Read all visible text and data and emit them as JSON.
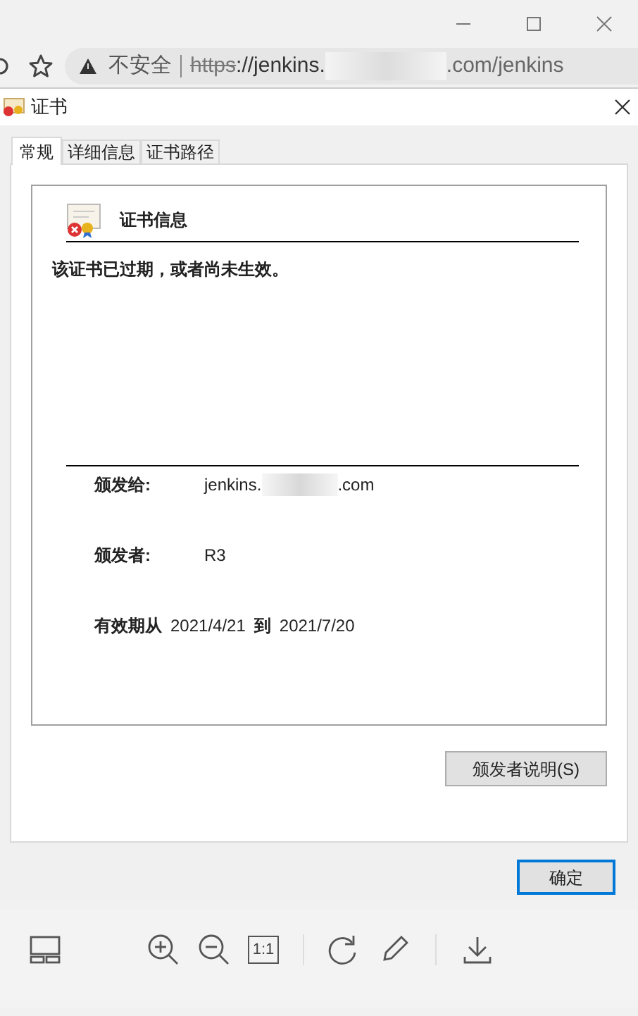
{
  "browser": {
    "security_label": "不安全",
    "url_scheme": "https",
    "url_host_start": "://jenkins.",
    "url_rest": ".com/jenkins"
  },
  "dialog": {
    "title": "证书",
    "tabs": [
      {
        "label": "常规",
        "selected": true
      },
      {
        "label": "详细信息",
        "selected": false
      },
      {
        "label": "证书路径",
        "selected": false
      }
    ],
    "info_title": "证书信息",
    "status_message": "该证书已过期，或者尚未生效。",
    "issued_to": {
      "label": "颁发给:",
      "value_start": "jenkins.",
      "value_end": ".com"
    },
    "issued_by": {
      "label": "颁发者:",
      "value": "R3"
    },
    "validity": {
      "from_label": "有效期从",
      "from": "2021/4/21",
      "to_label": "到",
      "to": "2021/7/20"
    },
    "issuer_statement_button": "颁发者说明(S)",
    "ok_button": "确定"
  },
  "viewer_toolbar": {
    "actual_size_label": "1:1"
  }
}
